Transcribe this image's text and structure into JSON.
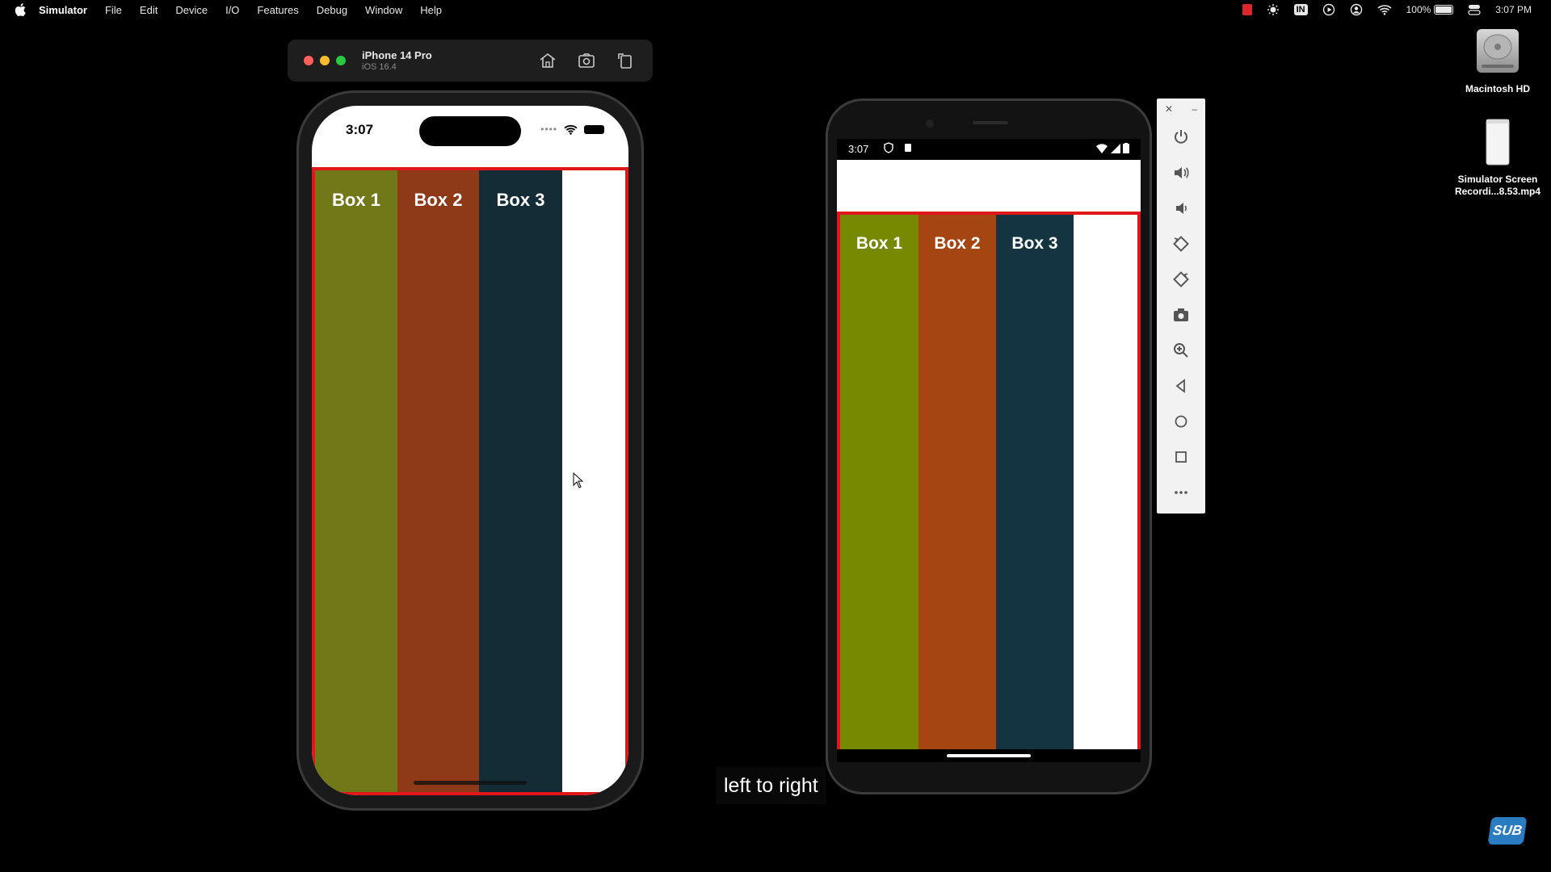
{
  "menubar": {
    "app_name": "Simulator",
    "items": [
      "File",
      "Edit",
      "Device",
      "I/O",
      "Features",
      "Debug",
      "Window",
      "Help"
    ],
    "status": {
      "input_badge": "IN",
      "battery": "100%",
      "clock": "3:07 PM"
    }
  },
  "desktop": {
    "icons": [
      {
        "label": "Macintosh HD",
        "icon": "hard-drive-icon"
      },
      {
        "label": "Simulator Screen Recordi...8.53.mp4",
        "icon": "video-file-icon"
      }
    ]
  },
  "ios_simulator": {
    "device_name": "iPhone 14 Pro",
    "os_version": "iOS 16.4",
    "toolbar_icons": [
      "home-icon",
      "screenshot-icon",
      "rotate-icon"
    ],
    "status_time": "3:07",
    "container_border_color": "#e0161b",
    "boxes": [
      {
        "label": "Box 1",
        "color": "#717818"
      },
      {
        "label": "Box 2",
        "color": "#8f3a17"
      },
      {
        "label": "Box 3",
        "color": "#132c35"
      }
    ]
  },
  "android_emulator": {
    "status_time": "3:07",
    "container_border_color": "#e0161b",
    "boxes": [
      {
        "label": "Box 1",
        "color": "#778900"
      },
      {
        "label": "Box 2",
        "color": "#a44512"
      },
      {
        "label": "Box 3",
        "color": "#133440"
      }
    ],
    "panel_buttons": [
      "power-icon",
      "volume-up-icon",
      "volume-down-icon",
      "rotate-left-icon",
      "rotate-right-icon",
      "camera-icon",
      "zoom-icon",
      "back-icon",
      "home-icon",
      "overview-icon",
      "more-icon"
    ]
  },
  "caption": "left to right",
  "watermark": "SUB"
}
